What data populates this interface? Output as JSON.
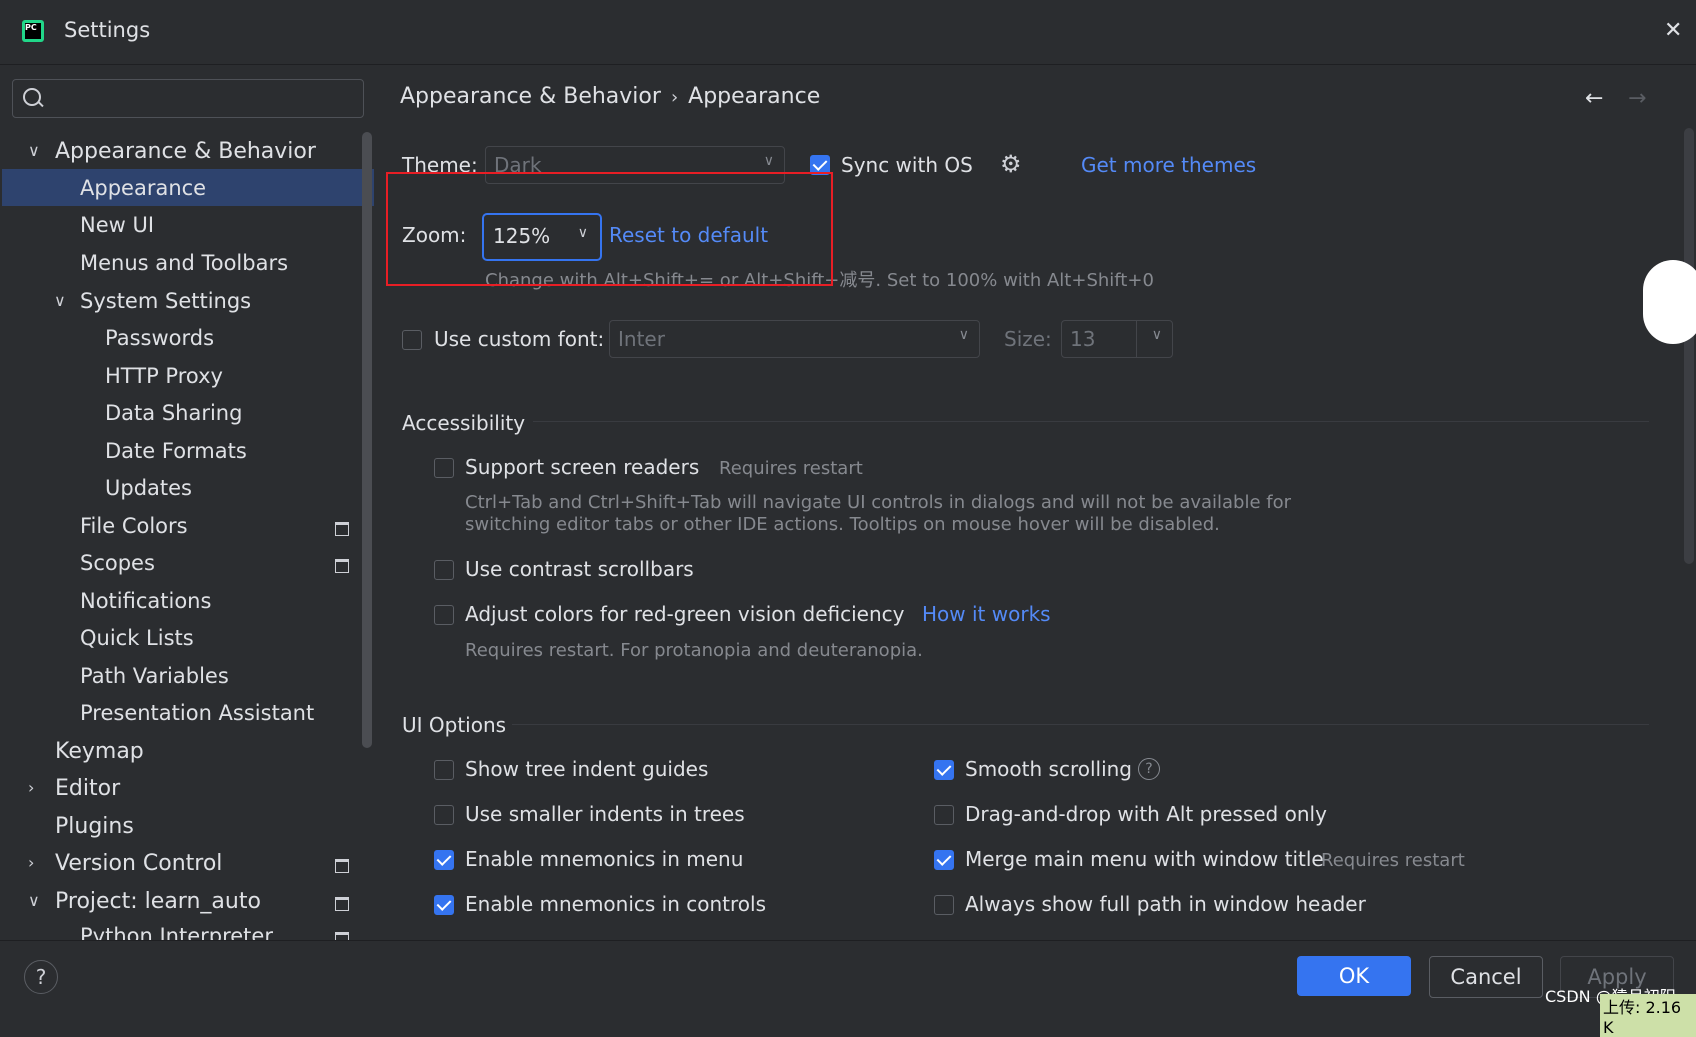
{
  "window": {
    "title": "Settings"
  },
  "sidebar": {
    "search_placeholder": "",
    "items": [
      {
        "label": "Appearance & Behavior",
        "expanded": true
      },
      {
        "label": "Appearance",
        "selected": true
      },
      {
        "label": "New UI"
      },
      {
        "label": "Menus and Toolbars"
      },
      {
        "label": "System Settings",
        "expanded": true
      },
      {
        "label": "Passwords"
      },
      {
        "label": "HTTP Proxy"
      },
      {
        "label": "Data Sharing"
      },
      {
        "label": "Date Formats"
      },
      {
        "label": "Updates"
      },
      {
        "label": "File Colors"
      },
      {
        "label": "Scopes"
      },
      {
        "label": "Notifications"
      },
      {
        "label": "Quick Lists"
      },
      {
        "label": "Path Variables"
      },
      {
        "label": "Presentation Assistant"
      },
      {
        "label": "Keymap"
      },
      {
        "label": "Editor"
      },
      {
        "label": "Plugins"
      },
      {
        "label": "Version Control"
      },
      {
        "label": "Project: learn_auto",
        "expanded": true
      },
      {
        "label": "Python Interpreter"
      }
    ]
  },
  "breadcrumb": {
    "parent": "Appearance & Behavior",
    "sep": "›",
    "current": "Appearance"
  },
  "nav": {
    "back": "←",
    "forward": "→"
  },
  "theme": {
    "label": "Theme:",
    "value": "Dark",
    "sync_label": "Sync with OS",
    "sync_checked": true,
    "more_link": "Get more themes"
  },
  "zoom": {
    "label": "Zoom:",
    "value": "125%",
    "reset_link": "Reset to default",
    "hint": "Change with Alt+Shift+= or Alt+Shift+减号. Set to 100% with Alt+Shift+0"
  },
  "custom_font": {
    "label": "Use custom font:",
    "checked": false,
    "font_value": "Inter",
    "size_label": "Size:",
    "size_value": "13"
  },
  "accessibility": {
    "title": "Accessibility",
    "screen_readers": {
      "label": "Support screen readers",
      "note": "Requires restart",
      "checked": false
    },
    "screen_readers_hint1": "Ctrl+Tab and Ctrl+Shift+Tab will navigate UI controls in dialogs and will not be available for",
    "screen_readers_hint2": "switching editor tabs or other IDE actions. Tooltips on mouse hover will be disabled.",
    "contrast_scrollbars": {
      "label": "Use contrast scrollbars",
      "checked": false
    },
    "color_deficiency": {
      "label": "Adjust colors for red-green vision deficiency",
      "link": "How it works",
      "checked": false
    },
    "color_deficiency_hint": "Requires restart. For protanopia and deuteranopia."
  },
  "ui_options": {
    "title": "UI Options",
    "left": [
      {
        "label": "Show tree indent guides",
        "checked": false
      },
      {
        "label": "Use smaller indents in trees",
        "checked": false
      },
      {
        "label": "Enable mnemonics in menu",
        "checked": true
      },
      {
        "label": "Enable mnemonics in controls",
        "checked": true
      }
    ],
    "right": [
      {
        "label": "Smooth scrolling",
        "checked": true
      },
      {
        "label": "Drag-and-drop with Alt pressed only",
        "checked": false
      },
      {
        "label": "Merge main menu with window title",
        "note": "Requires restart",
        "checked": true
      },
      {
        "label": "Always show full path in window header",
        "checked": false
      }
    ]
  },
  "footer": {
    "help": "?",
    "ok": "OK",
    "cancel": "Cancel",
    "apply": "Apply"
  },
  "watermark": {
    "text": "CSDN @猿月初阳",
    "upload": "上传: 2.16 K"
  },
  "colors": {
    "accent": "#3574f0",
    "link": "#548af7",
    "highlight_box": "#e81e25",
    "selected_bg": "#2e436e",
    "bg": "#2b2d30"
  }
}
